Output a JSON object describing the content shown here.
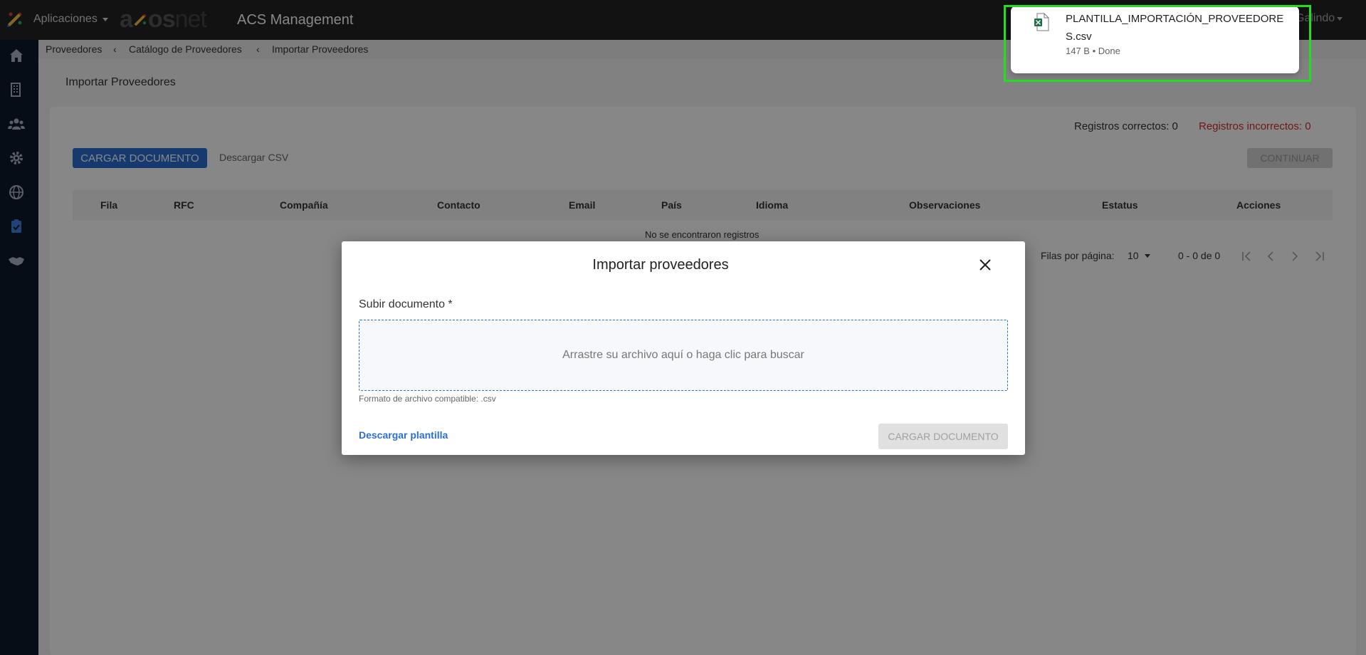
{
  "topbar": {
    "apps_label": "Aplicaciones",
    "brand_a": "a",
    "brand_os": "os",
    "brand_net": "net",
    "app_title": "ACS Management",
    "user_name": "l Galindo"
  },
  "sidebar": {
    "items": [
      {
        "icon": "home-icon"
      },
      {
        "icon": "building-icon"
      },
      {
        "icon": "users-icon"
      },
      {
        "icon": "gear-icon"
      },
      {
        "icon": "globe-icon"
      },
      {
        "icon": "clipboard-check-icon"
      },
      {
        "icon": "handshake-icon"
      }
    ]
  },
  "breadcrumb": {
    "items": [
      "Proveedores",
      "Catálogo de Proveedores",
      "Importar Proveedores"
    ],
    "separator": "‹"
  },
  "page": {
    "heading": "Importar Proveedores",
    "correct_label": "Registros correctos: 0",
    "incorrect_label": "Registros incorrectos: 0",
    "upload_button": "CARGAR DOCUMENTO",
    "download_csv": "Descargar CSV",
    "continue_button": "CONTINUAR",
    "columns": [
      "Fila",
      "RFC",
      "Compañía",
      "Contacto",
      "Email",
      "País",
      "Idioma",
      "Observaciones",
      "Estatus",
      "Acciones"
    ],
    "empty_message": "No se encontraron registros",
    "pager": {
      "rows_per_page_label": "Filas por página:",
      "rows_per_page_value": "10",
      "range": "0 - 0 de 0"
    }
  },
  "modal": {
    "title": "Importar proveedores",
    "field_label": "Subir documento *",
    "dropzone_text": "Arrastre su archivo aquí o haga clic para buscar",
    "hint": "Formato de archivo compatible: .csv",
    "download_template": "Descargar plantilla",
    "upload_button": "CARGAR DOCUMENTO"
  },
  "download": {
    "filename": "PLANTILLA_IMPORTACIÓN_PROVEEDORES.csv",
    "meta": "147 B • Done"
  },
  "colors": {
    "topbar": "#232323",
    "sidebar": "#0f1a2a",
    "primary": "#2a6fd3",
    "error": "#d32f2f",
    "highlight": "#22dd22"
  }
}
